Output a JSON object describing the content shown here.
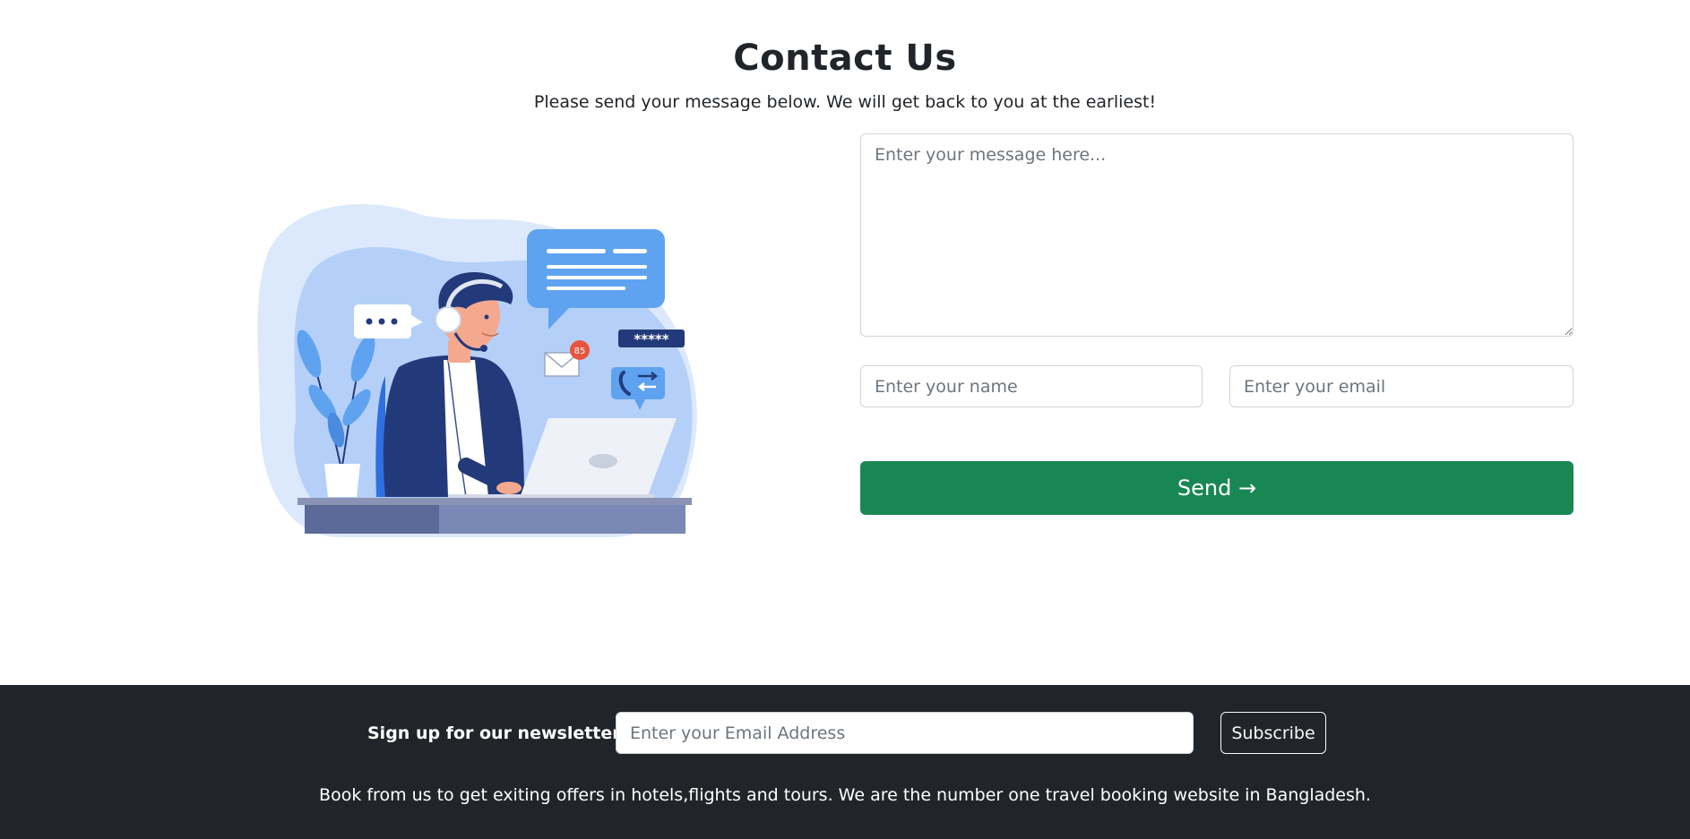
{
  "contact": {
    "title": "Contact Us",
    "subtitle": "Please send your message below. We will get back to you at the earliest!",
    "message_placeholder": "Enter your message here...",
    "name_placeholder": "Enter your name",
    "email_placeholder": "Enter your email",
    "send_label": "Send →"
  },
  "illustration": {
    "badge_count": "85",
    "password_mask": "*****",
    "chat_dots": "•••"
  },
  "footer": {
    "newsletter_label": "Sign up for our newsletter",
    "email_placeholder": "Enter your Email Address",
    "subscribe_label": "Subscribe",
    "tagline": "Book from us to get exiting offers in hotels,flights and tours. We are the number one travel booking website in Bangladesh."
  },
  "colors": {
    "primary_green": "#198754",
    "footer_bg": "#212529",
    "illustration_blue": "#5fa3f0",
    "illustration_navy": "#233a7a"
  }
}
